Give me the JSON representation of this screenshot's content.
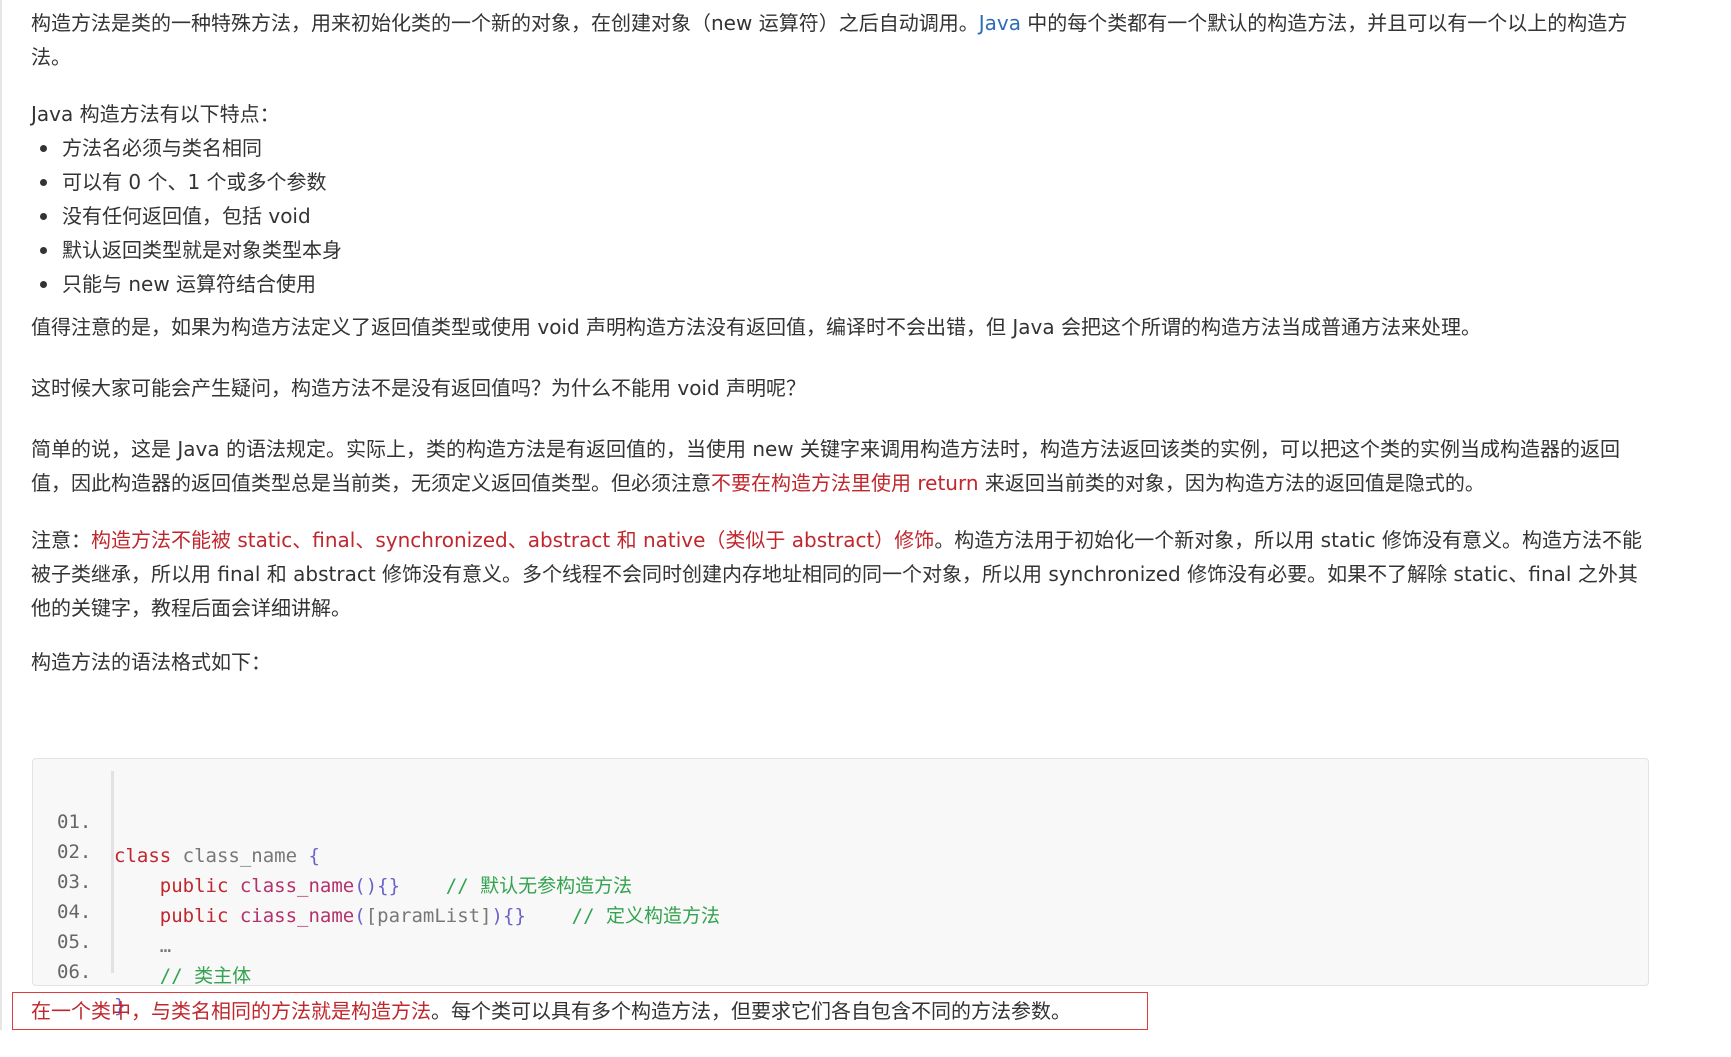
{
  "intro": {
    "part1": "构造方法是类的一种特殊方法，用来初始化类的一个新的对象，在创建对象（new 运算符）之后自动调用。",
    "link_java": "Java",
    "part2": " 中的每个类都有一个默认的构造方法，并且可以有一个以上的构造方法。"
  },
  "features": {
    "heading": "Java 构造方法有以下特点：",
    "items": [
      "方法名必须与类名相同",
      "可以有 0 个、1 个或多个参数",
      "没有任何返回值，包括 void",
      "默认返回类型就是对象类型本身",
      "只能与 new 运算符结合使用"
    ]
  },
  "para_note_return": "值得注意的是，如果为构造方法定义了返回值类型或使用 void 声明构造方法没有返回值，编译时不会出错，但 Java 会把这个所谓的构造方法当成普通方法来处理。",
  "para_question": "这时候大家可能会产生疑问，构造方法不是没有返回值吗？为什么不能用 void 声明呢？",
  "para_explain": {
    "part1": "简单的说，这是 Java 的语法规定。实际上，类的构造方法是有返回值的，当使用 new 关键字来调用构造方法时，构造方法返回该类的实例，可以把这个类的实例当成构造器的返回值，因此构造器的返回值类型总是当前类，无须定义返回值类型。但必须注意",
    "red": "不要在构造方法里使用 return",
    "part2": " 来返回当前类的对象，因为构造方法的返回值是隐式的。"
  },
  "para_modifiers": {
    "prefix": "注意：",
    "red": "构造方法不能被 static、final、synchronized、abstract 和 native（类似于 abstract）修饰",
    "rest": "。构造方法用于初始化一个新对象，所以用 static 修饰没有意义。构造方法不能被子类继承，所以用 final 和 abstract 修饰没有意义。多个线程不会同时创建内存地址相同的同一个对象，所以用 synchronized 修饰没有必要。如果不了解除 static、final 之外其他的关键字，教程后面会详细讲解。"
  },
  "syntax_label": "构造方法的语法格式如下：",
  "code": {
    "line_numbers": [
      "01.",
      "02.",
      "03.",
      "04.",
      "05.",
      "06."
    ],
    "l1": {
      "kw": "class",
      "name": " class_name ",
      "brace": "{"
    },
    "l2": {
      "indent": "    ",
      "kw": "public",
      "name": " class_name",
      "parens": "()",
      "braces": "{}",
      "gap": "    ",
      "comment": "// 默认无参构造方法"
    },
    "l3": {
      "indent": "    ",
      "kw": "public",
      "name": " ciass_name",
      "open": "(",
      "params": "[paramList]",
      "close": ")",
      "braces": "{}",
      "gap": "    ",
      "comment": "// 定义构造方法"
    },
    "l4": {
      "indent": "    ",
      "text": "…"
    },
    "l5": {
      "indent": "    ",
      "comment": "// 类主体"
    },
    "l6": {
      "brace": "}"
    }
  },
  "callout": {
    "red": "在一个类中，与类名相同的方法就是构造方法",
    "rest": "。每个类可以具有多个构造方法，但要求它们各自包含不同的方法参数。"
  },
  "colors": {
    "text": "#333333",
    "link": "#2c6db5",
    "highlight_red": "#c0272d",
    "callout_border": "#e23b3b",
    "code_bg": "#f8f8f8",
    "code_comment": "#34a34f",
    "code_keyword": "#c0272d",
    "code_function": "#b4316b",
    "code_bracket": "#6a63c9"
  }
}
